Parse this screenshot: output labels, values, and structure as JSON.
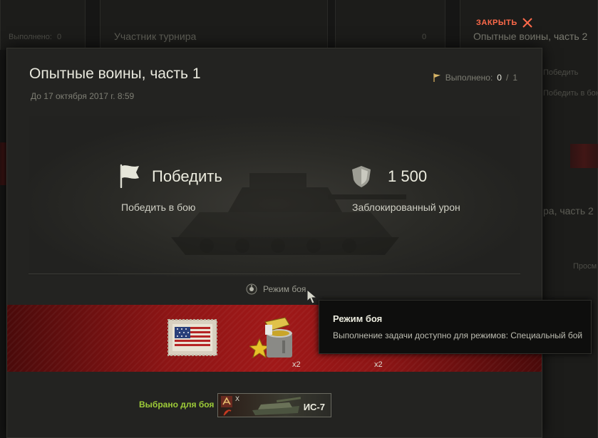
{
  "background": {
    "left_card_label": "Выполнено:",
    "left_card_value": "0",
    "tournament_title": "Участник турнира",
    "center_card_value": "0",
    "right_card_title": "Опытные воины, часть 2",
    "right_card_line1": "Победить",
    "right_card_line2": "Победить в бою",
    "right_card_title_repeat": "ра, часть 2",
    "right_card_status": "Просм"
  },
  "close_button": {
    "label": "ЗАКРЫТЬ",
    "icon": "close-icon"
  },
  "quest": {
    "title": "Опытные воины, часть 1",
    "deadline": "До 17 октября 2017 г. 8:59",
    "progress_label": "Выполнено:",
    "progress_current": "0",
    "progress_separator": "/",
    "progress_total": "1"
  },
  "conditions": [
    {
      "icon": "flag-icon",
      "title": "Победить",
      "description": "Победить в бою"
    },
    {
      "icon": "shield-icon",
      "title": "1 500",
      "description": "Заблокированный урон"
    }
  ],
  "battle_mode": {
    "label": "Режим боя",
    "icon": "battle-mode-icon"
  },
  "rewards": [
    {
      "icon": "american-stamp-icon",
      "quantity": ""
    },
    {
      "icon": "paint-bucket-star-icon",
      "quantity": "x2"
    },
    {
      "icon": "hidden-reward-icon",
      "quantity": "x2"
    }
  ],
  "selected_for_battle": {
    "label": "Выбрано для боя",
    "vehicle_name": "ИС-7",
    "multiplier": "X"
  },
  "tooltip": {
    "title": "Режим боя",
    "text": "Выполнение задачи доступно для режимов: Специальный бой"
  },
  "colors": {
    "accent_close": "#ff6a4a",
    "selected_label": "#9ecc38",
    "reward_strip": "#a01818"
  }
}
